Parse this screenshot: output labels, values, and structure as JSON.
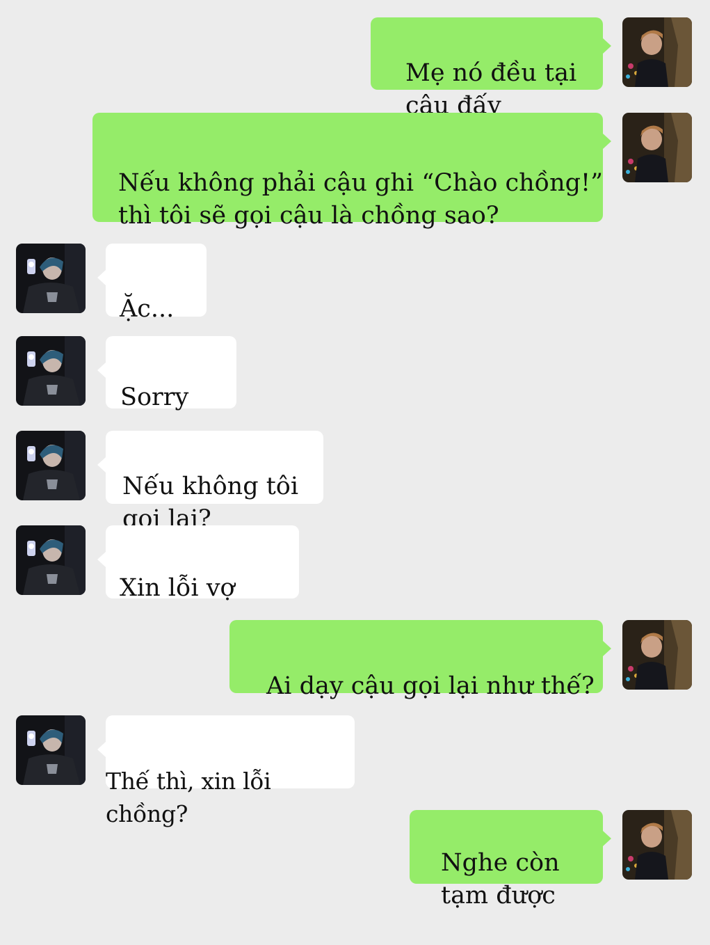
{
  "colors": {
    "background": "#ececec",
    "outgoing_bubble": "#95ec69",
    "incoming_bubble": "#ffffff"
  },
  "messages": [
    {
      "sender": "me",
      "text": "Mẹ nó đều tại\n cậu đấy"
    },
    {
      "sender": "me",
      "text": "Nếu không phải cậu ghi “Chào chồng!”\nthì tôi sẽ gọi cậu là chồng sao?"
    },
    {
      "sender": "them",
      "text": "Ặc..."
    },
    {
      "sender": "them",
      "text": "Sorry"
    },
    {
      "sender": "them",
      "text": "Nếu không tôi\ngọi lại?"
    },
    {
      "sender": "them",
      "text": "Xin lỗi vợ"
    },
    {
      "sender": "me",
      "text": "Ai dạy cậu gọi lại như thế?"
    },
    {
      "sender": "them",
      "text": "Thế thì, xin lỗi chồng?"
    },
    {
      "sender": "me",
      "text": "Nghe còn\ntạm được"
    }
  ],
  "avatars": {
    "me": "user-avatar-icon",
    "them": "contact-avatar-icon"
  }
}
